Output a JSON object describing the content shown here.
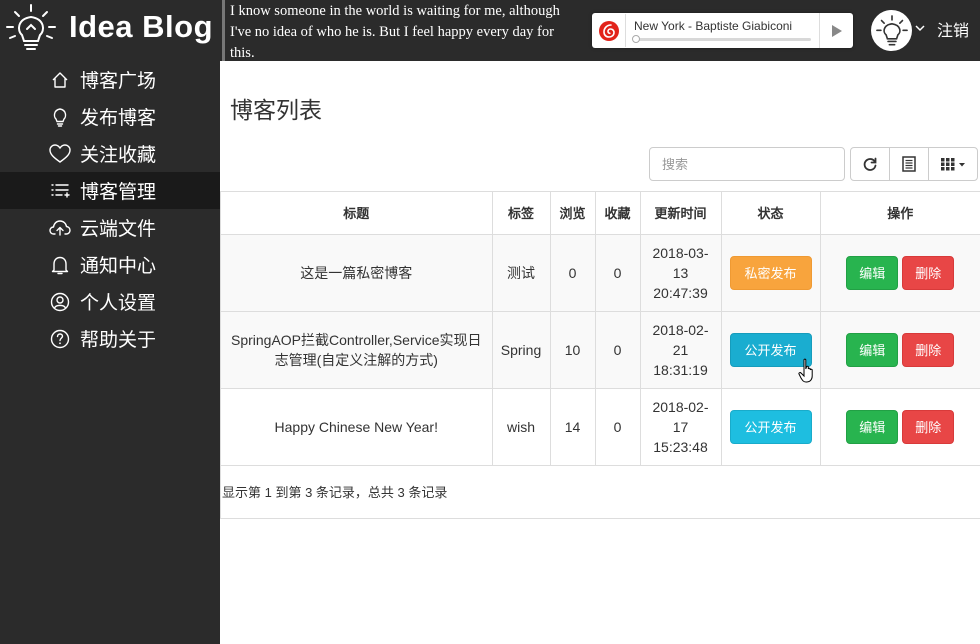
{
  "header": {
    "brand": "Idea Blog",
    "quote": "I know someone in the world is waiting for me, although I've no idea of who he is. But I feel happy every day for this.",
    "music_player": {
      "song": "New York - Baptiste Giabiconi",
      "progress": 0.0
    },
    "logout": "注销"
  },
  "sidebar": {
    "items": [
      {
        "label": "博客广场",
        "icon": "home-icon",
        "active": false
      },
      {
        "label": "发布博客",
        "icon": "lightbulb-icon",
        "active": false
      },
      {
        "label": "关注收藏",
        "icon": "heart-icon",
        "active": false
      },
      {
        "label": "博客管理",
        "icon": "list-icon",
        "active": true
      },
      {
        "label": "云端文件",
        "icon": "cloud-upload-icon",
        "active": false
      },
      {
        "label": "通知中心",
        "icon": "bell-icon",
        "active": false
      },
      {
        "label": "个人设置",
        "icon": "user-icon",
        "active": false
      },
      {
        "label": "帮助关于",
        "icon": "help-icon",
        "active": false
      }
    ]
  },
  "main": {
    "title": "博客列表",
    "search_placeholder": "搜索",
    "toolbar": {
      "refresh_icon": "refresh-icon",
      "toggle_view_icon": "list-view-icon",
      "columns_icon": "columns-icon"
    },
    "table": {
      "columns": [
        "标题",
        "标签",
        "浏览",
        "收藏",
        "更新时间",
        "状态",
        "操作"
      ],
      "rows": [
        {
          "title": "这是一篇私密博客",
          "tag": "测试",
          "views": "0",
          "favorites": "0",
          "updated": "2018-03-13 20:47:39",
          "status": "私密发布",
          "status_color": "#f8a43d",
          "edit": "编辑",
          "delete": "删除"
        },
        {
          "title": "SpringAOP拦截Controller,Service实现日志管理(自定义注解的方式)",
          "tag": "Spring",
          "views": "10",
          "favorites": "0",
          "updated": "2018-02-21 18:31:19",
          "status": "公开发布",
          "status_color": "#1aadd0",
          "edit": "编辑",
          "delete": "删除"
        },
        {
          "title": "Happy Chinese New Year!",
          "tag": "wish",
          "views": "14",
          "favorites": "0",
          "updated": "2018-02-17 15:23:48",
          "status": "公开发布",
          "status_color": "#1ebee0",
          "edit": "编辑",
          "delete": "删除"
        }
      ]
    },
    "pagination_info": "显示第 1 到第 3 条记录，总共 3 条记录"
  },
  "colors": {
    "sidebar_bg": "#2b2b2b",
    "active_item_bg": "#1a1a1a",
    "edit_green": "#28b44f",
    "delete_red": "#e84646"
  }
}
